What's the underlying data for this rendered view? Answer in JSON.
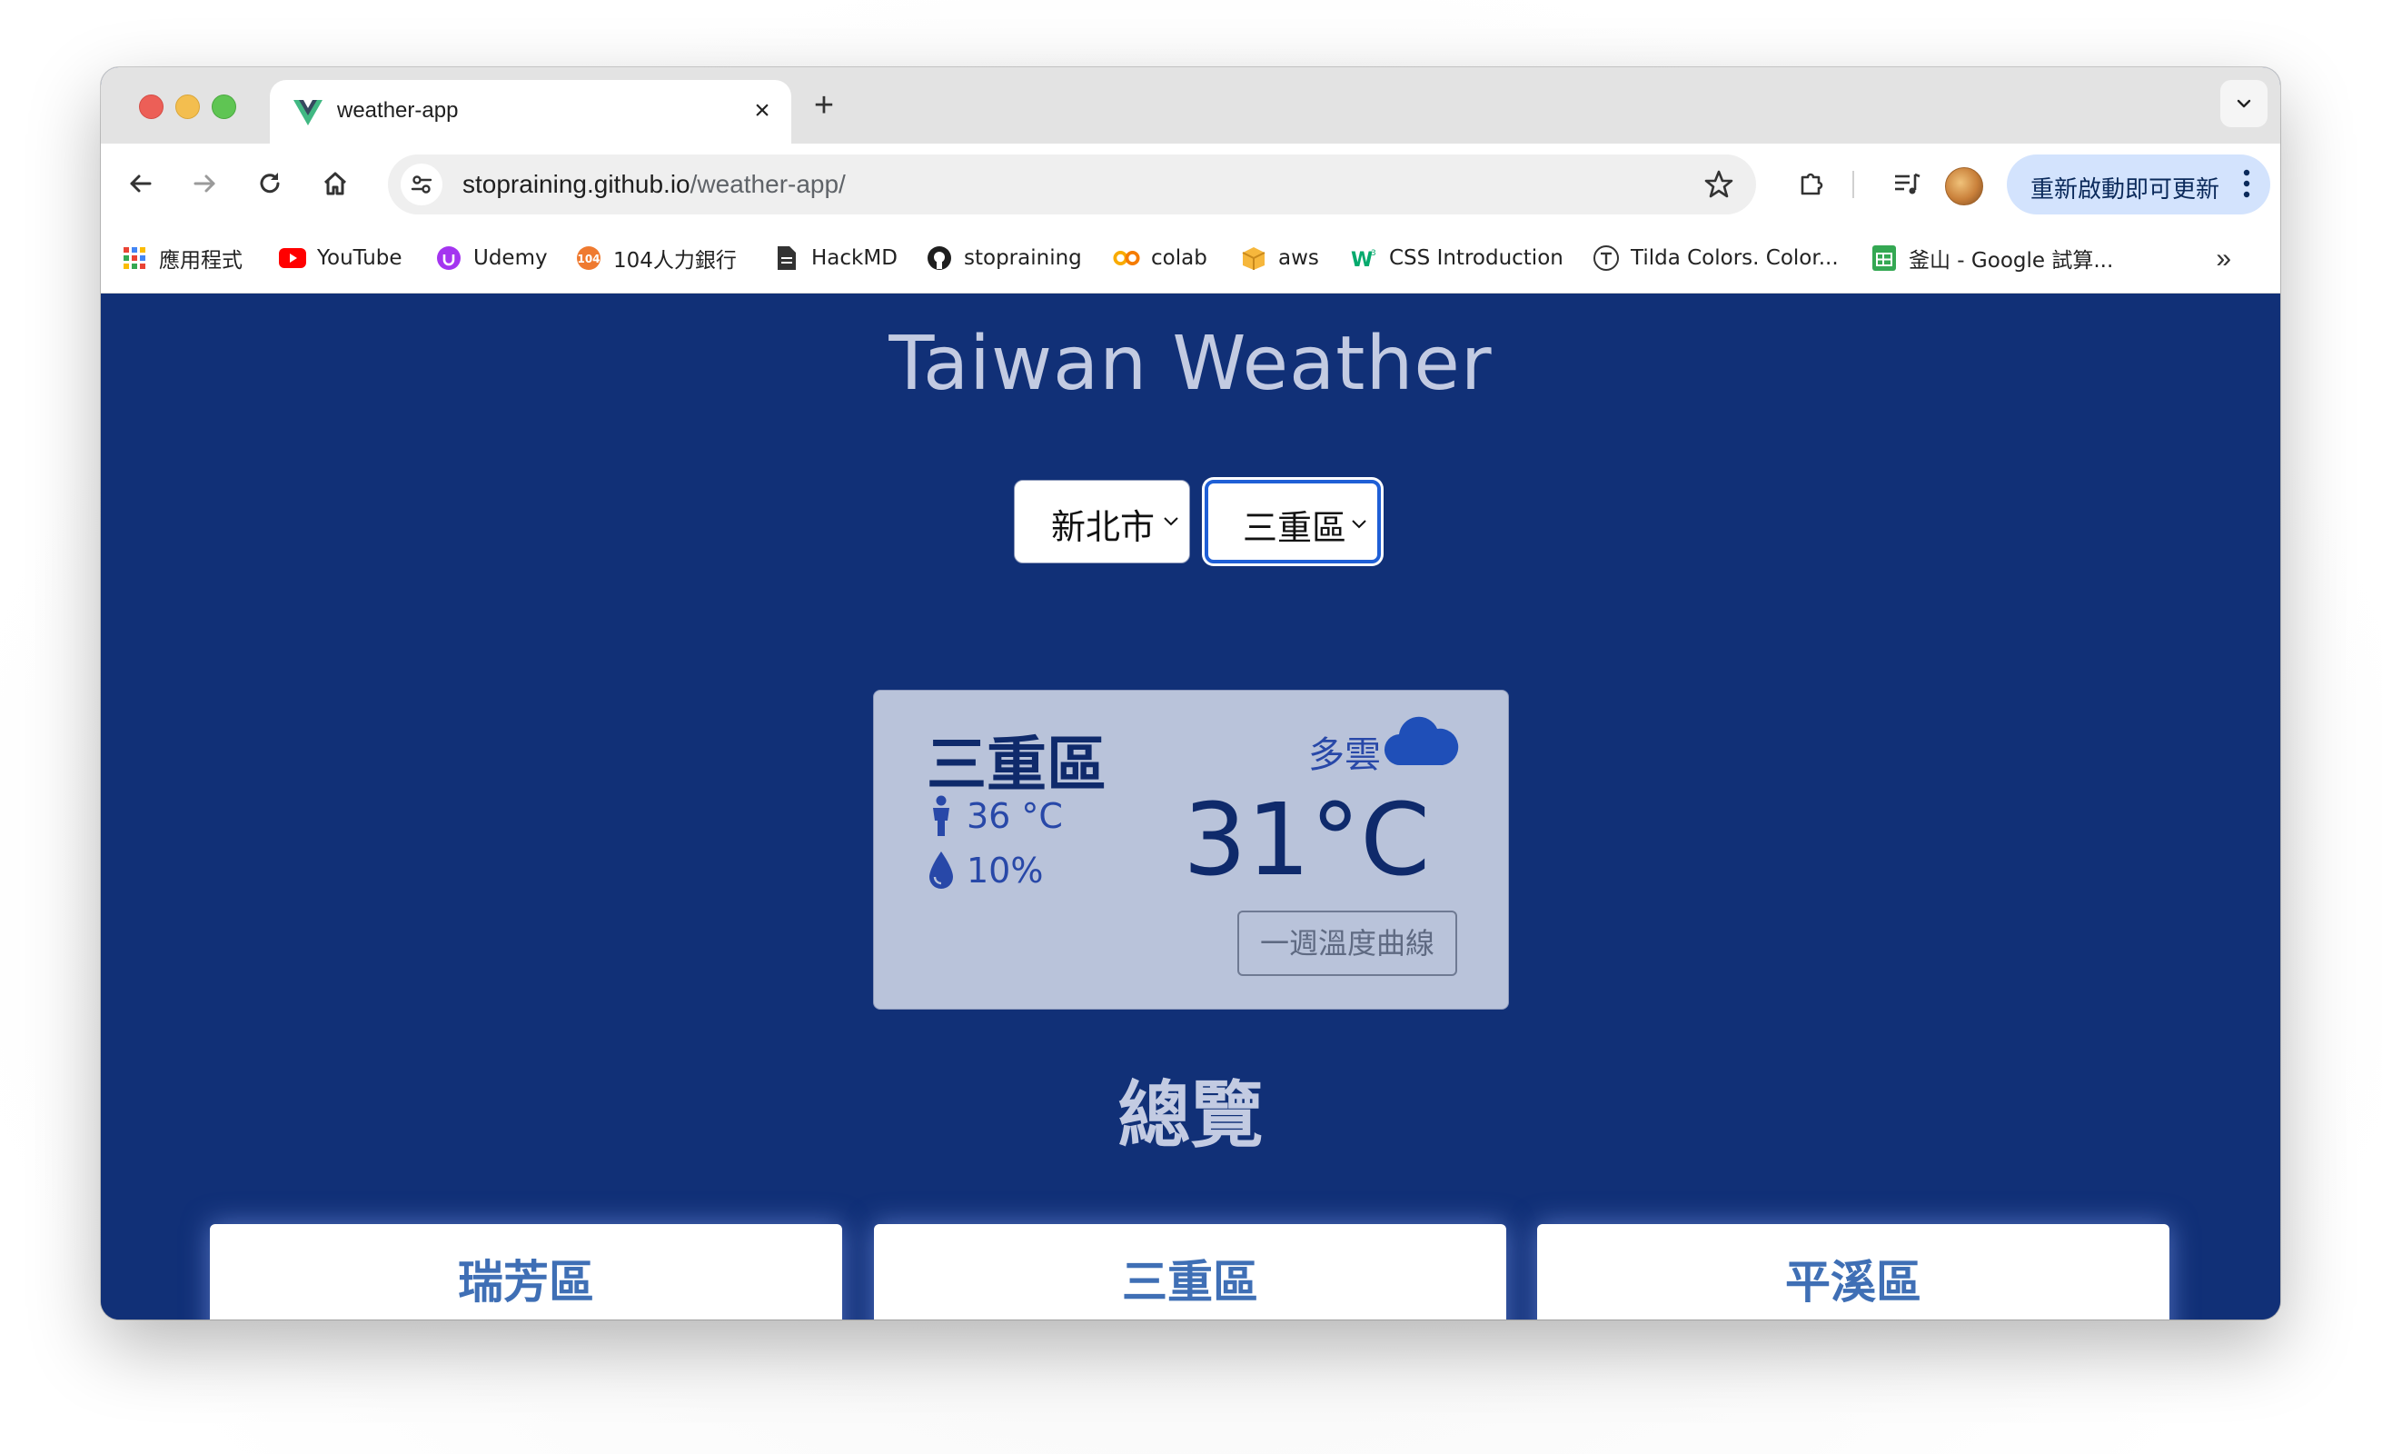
{
  "browser": {
    "tab_title": "weather-app",
    "url_host": "stopraining.github.io",
    "url_path": "/weather-app/",
    "update_button_label": "重新啟動即可更新"
  },
  "bookmarks": [
    {
      "label": "應用程式",
      "icon": "apps-grid-icon"
    },
    {
      "label": "YouTube",
      "icon": "youtube-icon"
    },
    {
      "label": "Udemy",
      "icon": "udemy-icon"
    },
    {
      "label": "104人力銀行",
      "icon": "104-icon"
    },
    {
      "label": "HackMD",
      "icon": "document-icon"
    },
    {
      "label": "stopraining",
      "icon": "github-icon"
    },
    {
      "label": "colab",
      "icon": "colab-icon"
    },
    {
      "label": "aws",
      "icon": "aws-box-icon"
    },
    {
      "label": "CSS Introduction",
      "icon": "w3schools-icon"
    },
    {
      "label": "Tilda Colors. Color...",
      "icon": "tilda-icon"
    },
    {
      "label": "釜山 - Google 試算...",
      "icon": "google-sheets-icon"
    }
  ],
  "app": {
    "title": "Taiwan Weather",
    "city_select": "新北市",
    "district_select": "三重區",
    "current": {
      "location": "三重區",
      "feels_like": "36 °C",
      "rain_chance": "10%",
      "description": "多雲",
      "temperature": "31°C",
      "week_button": "一週溫度曲線"
    },
    "overview_title": "總覽",
    "overview_districts": [
      "瑞芳區",
      "三重區",
      "平溪區"
    ]
  },
  "colors": {
    "page_bg": "#113077",
    "card_bg": "#b9c3da",
    "accent": "#2848a8"
  }
}
